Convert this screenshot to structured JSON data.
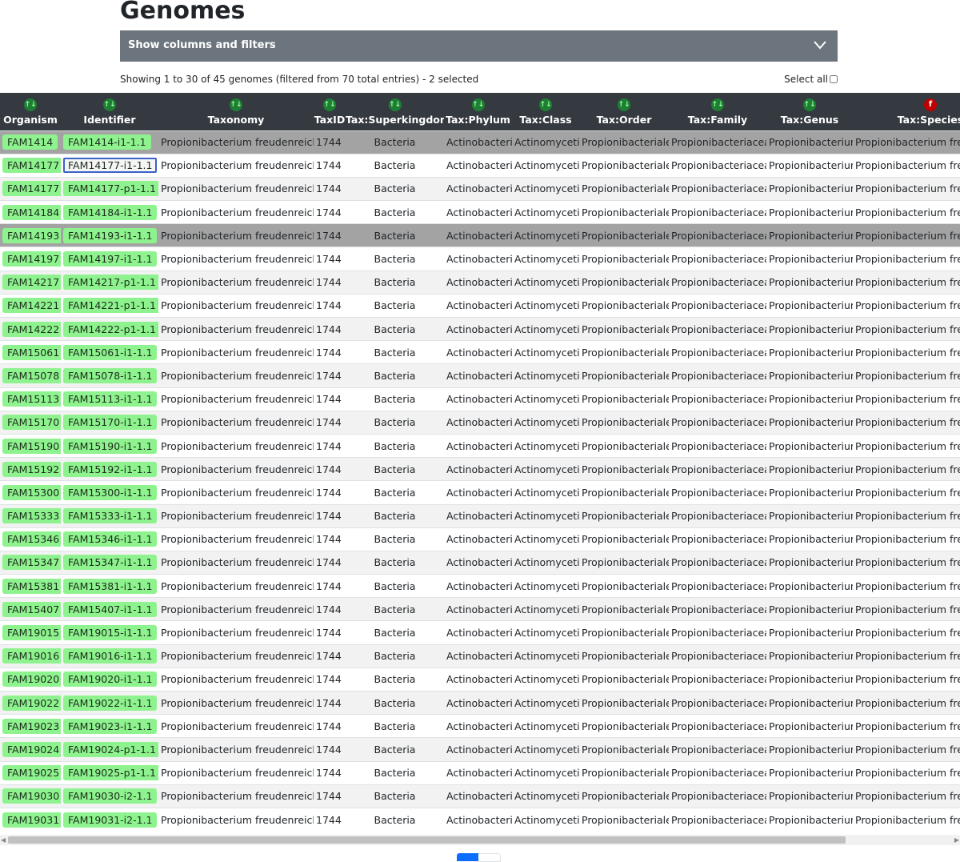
{
  "page": {
    "title": "Genomes"
  },
  "filters": {
    "toggle_label": "Show columns and filters"
  },
  "summary": {
    "text": "Showing 1 to 30 of 45 genomes (filtered from 70 total entries) - 2 selected"
  },
  "select_all": {
    "label": "Select all"
  },
  "columns": [
    {
      "key": "organism",
      "label": "Organism",
      "filtered": false
    },
    {
      "key": "identifier",
      "label": "Identifier",
      "filtered": false
    },
    {
      "key": "taxonomy",
      "label": "Taxonomy",
      "filtered": false
    },
    {
      "key": "taxid",
      "label": "TaxID",
      "filtered": false
    },
    {
      "key": "superkingdom",
      "label": "Tax:Superkingdom",
      "filtered": false
    },
    {
      "key": "phylum",
      "label": "Tax:Phylum",
      "filtered": false
    },
    {
      "key": "class",
      "label": "Tax:Class",
      "filtered": false
    },
    {
      "key": "order",
      "label": "Tax:Order",
      "filtered": false
    },
    {
      "key": "family",
      "label": "Tax:Family",
      "filtered": false
    },
    {
      "key": "genus",
      "label": "Tax:Genus",
      "filtered": false
    },
    {
      "key": "species",
      "label": "Tax:Species",
      "filtered": true
    }
  ],
  "sort_icons": {
    "sortable": "↑↓",
    "filtered": "f"
  },
  "shared_values": {
    "taxonomy": "Propionibacterium freudenreichii",
    "taxid": "1744",
    "superkingdom": "Bacteria",
    "phylum": "Actinobacteria",
    "class": "Actinomycetia",
    "order": "Propionibacteriales",
    "family": "Propionibacteriaceae",
    "genus": "Propionibacterium",
    "species": "Propionibacterium freudenreichii"
  },
  "rows": [
    {
      "organism": "FAM1414",
      "identifier": "FAM1414-i1-1.1",
      "selected": true,
      "focused": false
    },
    {
      "organism": "FAM14177",
      "identifier": "FAM14177-i1-1.1",
      "selected": false,
      "focused": true
    },
    {
      "organism": "FAM14177",
      "identifier": "FAM14177-p1-1.1",
      "selected": false,
      "focused": false
    },
    {
      "organism": "FAM14184",
      "identifier": "FAM14184-i1-1.1",
      "selected": false,
      "focused": false
    },
    {
      "organism": "FAM14193",
      "identifier": "FAM14193-i1-1.1",
      "selected": true,
      "focused": false
    },
    {
      "organism": "FAM14197",
      "identifier": "FAM14197-i1-1.1",
      "selected": false,
      "focused": false
    },
    {
      "organism": "FAM14217",
      "identifier": "FAM14217-p1-1.1",
      "selected": false,
      "focused": false
    },
    {
      "organism": "FAM14221",
      "identifier": "FAM14221-p1-1.1",
      "selected": false,
      "focused": false
    },
    {
      "organism": "FAM14222",
      "identifier": "FAM14222-p1-1.1",
      "selected": false,
      "focused": false
    },
    {
      "organism": "FAM15061",
      "identifier": "FAM15061-i1-1.1",
      "selected": false,
      "focused": false
    },
    {
      "organism": "FAM15078",
      "identifier": "FAM15078-i1-1.1",
      "selected": false,
      "focused": false
    },
    {
      "organism": "FAM15113",
      "identifier": "FAM15113-i1-1.1",
      "selected": false,
      "focused": false
    },
    {
      "organism": "FAM15170",
      "identifier": "FAM15170-i1-1.1",
      "selected": false,
      "focused": false
    },
    {
      "organism": "FAM15190",
      "identifier": "FAM15190-i1-1.1",
      "selected": false,
      "focused": false
    },
    {
      "organism": "FAM15192",
      "identifier": "FAM15192-i1-1.1",
      "selected": false,
      "focused": false
    },
    {
      "organism": "FAM15300",
      "identifier": "FAM15300-i1-1.1",
      "selected": false,
      "focused": false
    },
    {
      "organism": "FAM15333",
      "identifier": "FAM15333-i1-1.1",
      "selected": false,
      "focused": false
    },
    {
      "organism": "FAM15346",
      "identifier": "FAM15346-i1-1.1",
      "selected": false,
      "focused": false
    },
    {
      "organism": "FAM15347",
      "identifier": "FAM15347-i1-1.1",
      "selected": false,
      "focused": false
    },
    {
      "organism": "FAM15381",
      "identifier": "FAM15381-i1-1.1",
      "selected": false,
      "focused": false
    },
    {
      "organism": "FAM15407",
      "identifier": "FAM15407-i1-1.1",
      "selected": false,
      "focused": false
    },
    {
      "organism": "FAM19015",
      "identifier": "FAM19015-i1-1.1",
      "selected": false,
      "focused": false
    },
    {
      "organism": "FAM19016",
      "identifier": "FAM19016-i1-1.1",
      "selected": false,
      "focused": false
    },
    {
      "organism": "FAM19020",
      "identifier": "FAM19020-i1-1.1",
      "selected": false,
      "focused": false
    },
    {
      "organism": "FAM19022",
      "identifier": "FAM19022-i1-1.1",
      "selected": false,
      "focused": false
    },
    {
      "organism": "FAM19023",
      "identifier": "FAM19023-i1-1.1",
      "selected": false,
      "focused": false
    },
    {
      "organism": "FAM19024",
      "identifier": "FAM19024-p1-1.1",
      "selected": false,
      "focused": false
    },
    {
      "organism": "FAM19025",
      "identifier": "FAM19025-p1-1.1",
      "selected": false,
      "focused": false
    },
    {
      "organism": "FAM19030",
      "identifier": "FAM19030-i2-1.1",
      "selected": false,
      "focused": false
    },
    {
      "organism": "FAM19031",
      "identifier": "FAM19031-i2-1.1",
      "selected": false,
      "focused": false
    }
  ],
  "colors": {
    "header_bg": "#343a40",
    "chip_green": "#8ef38e",
    "selected_row": "#a3a3a3",
    "filter_bar": "#6c757d",
    "pager_active": "#0d6efd"
  }
}
